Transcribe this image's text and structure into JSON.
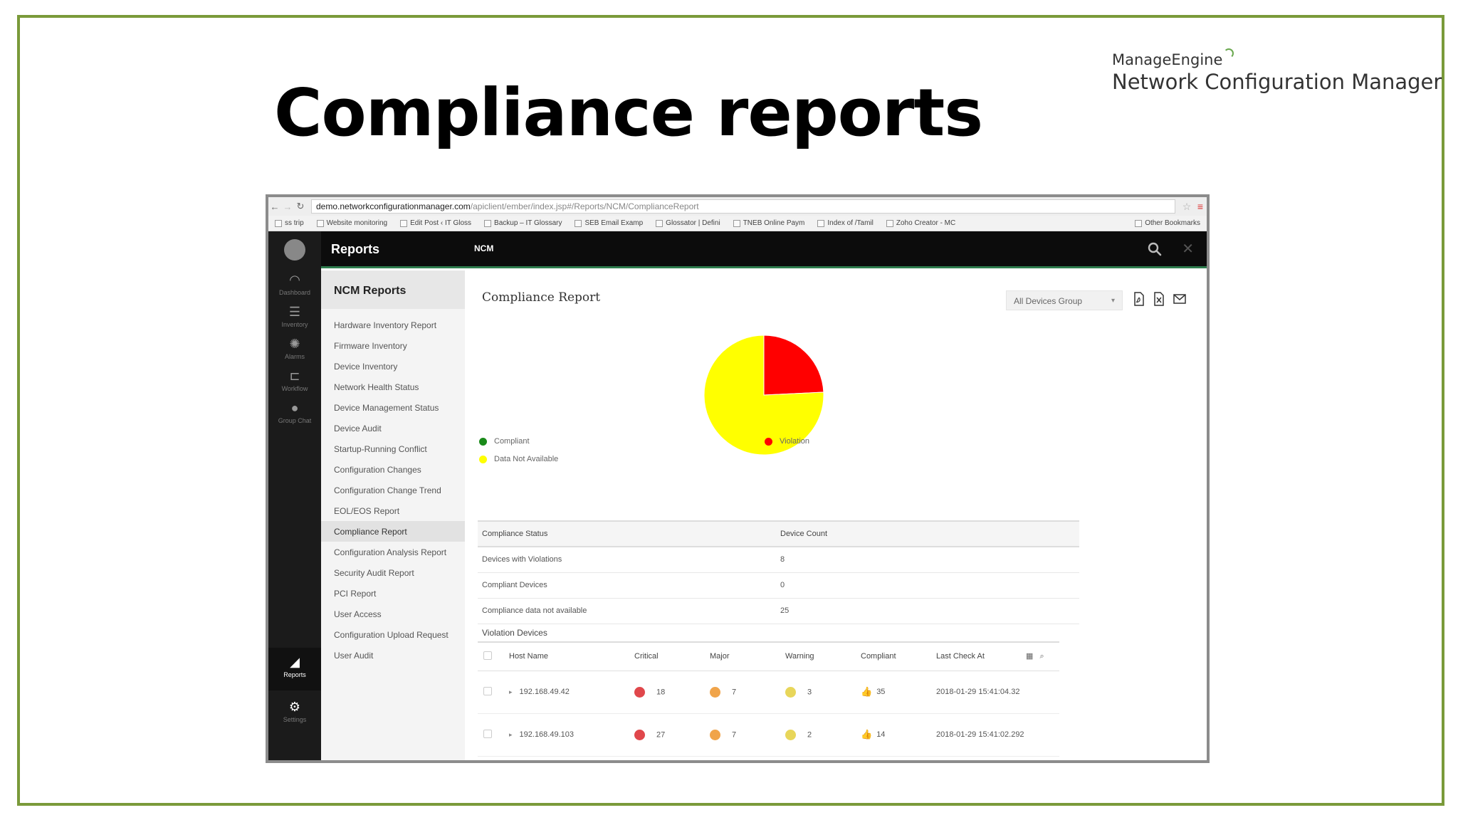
{
  "slide": {
    "title": "Compliance reports",
    "brand_top": "ManageEngine",
    "brand_bottom": "Network Configuration Manager"
  },
  "browser": {
    "url_host": "demo.networkconfigurationmanager.com",
    "url_path": "/apiclient/ember/index.jsp#/Reports/NCM/ComplianceReport",
    "bookmarks": [
      "ss trip",
      "Website monitoring",
      "Edit Post ‹ IT Gloss",
      "Backup – IT Glossary",
      "SEB Email Examp",
      "Glossator | Defini",
      "TNEB Online Paym",
      "Index of /Tamil",
      "Zoho Creator - MC",
      "Other Bookmarks"
    ]
  },
  "header": {
    "title": "Reports",
    "tab": "NCM",
    "search_icon": "search-icon",
    "close_icon": "close-icon"
  },
  "rail": {
    "items": [
      {
        "label": "Dashboard",
        "icon": "dashboard-icon",
        "glyph": "◠"
      },
      {
        "label": "Inventory",
        "icon": "inventory-icon",
        "glyph": "☰"
      },
      {
        "label": "Alarms",
        "icon": "alarm-icon",
        "glyph": "✺"
      },
      {
        "label": "Workflow",
        "icon": "workflow-icon",
        "glyph": "⊏"
      },
      {
        "label": "Group Chat",
        "icon": "chat-icon",
        "glyph": "●"
      }
    ],
    "reports_label": "Reports",
    "settings_label": "Settings"
  },
  "side": {
    "header": "NCM Reports",
    "items": [
      "Hardware Inventory Report",
      "Firmware Inventory",
      "Device Inventory",
      "Network Health Status",
      "Device Management Status",
      "Device Audit",
      "Startup-Running Conflict",
      "Configuration Changes",
      "Configuration Change Trend",
      "EOL/EOS Report",
      "Compliance Report",
      "Configuration Analysis Report",
      "Security Audit Report",
      "PCI Report",
      "User Access",
      "Configuration Upload Request",
      "User Audit"
    ],
    "active_index": 10
  },
  "report": {
    "title": "Compliance Report",
    "group_select": "All Devices Group",
    "colors": {
      "compliant": "#1a8a1a",
      "violation": "#ff0000",
      "na": "#ffff00"
    },
    "pie_values": {
      "violation": 8,
      "compliant": 0,
      "na": 25
    },
    "legend": {
      "compliant": "Compliant",
      "violation": "Violation",
      "na": "Data Not Available"
    },
    "status_head": {
      "status": "Compliance Status",
      "count": "Device Count"
    },
    "status_rows": [
      {
        "status": "Devices with Violations",
        "count": "8"
      },
      {
        "status": "Compliant Devices",
        "count": "0"
      },
      {
        "status": "Compliance data not available",
        "count": "25"
      }
    ],
    "violation_title": "Violation Devices",
    "violation_head": {
      "host": "Host Name",
      "critical": "Critical",
      "major": "Major",
      "warning": "Warning",
      "compliant": "Compliant",
      "last": "Last Check At"
    },
    "violation_rows": [
      {
        "host": "192.168.49.42",
        "critical": "18",
        "major": "7",
        "warning": "3",
        "compliant": "35",
        "last": "2018-01-29 15:41:04.32"
      },
      {
        "host": "192.168.49.103",
        "critical": "27",
        "major": "7",
        "warning": "2",
        "compliant": "14",
        "last": "2018-01-29 15:41:02.292"
      }
    ]
  }
}
